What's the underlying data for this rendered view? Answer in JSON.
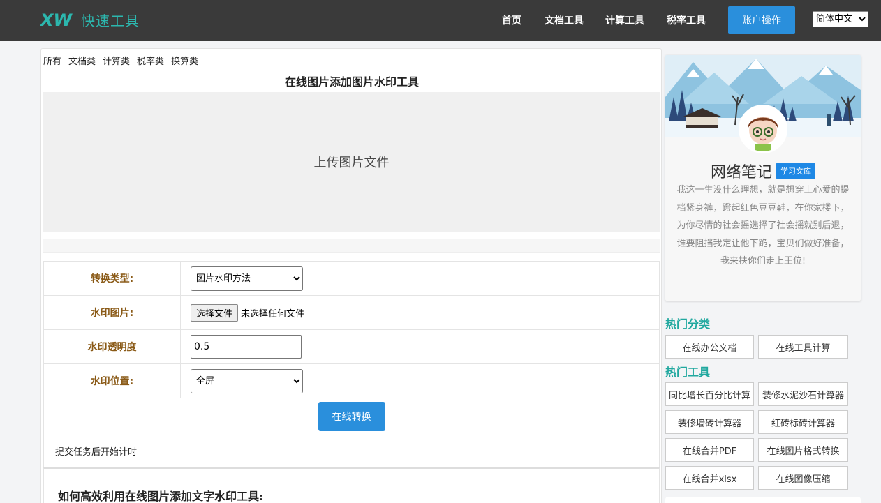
{
  "header": {
    "logo_mark": "XW",
    "logo_text": "快速工具",
    "nav": [
      "首页",
      "文档工具",
      "计算工具",
      "税率工具"
    ],
    "account_label": "账户操作",
    "language": "简体中文",
    "colors": {
      "bar": "#3a3a3a",
      "accent": "#2a8fdc",
      "brand": "#2cb7ae"
    }
  },
  "categories": [
    "所有",
    "文档类",
    "计算类",
    "税率类",
    "换算类"
  ],
  "page_title": "在线图片添加图片水印工具",
  "upload_label": "上传图片文件",
  "form": {
    "type_label": "转换类型:",
    "type_value": "图片水印方法",
    "image_label": "水印图片:",
    "file_button": "选择文件",
    "file_status": "未选择任何文件",
    "opacity_label": "水印透明度",
    "opacity_value": "0.5",
    "position_label": "水印位置:",
    "position_value": "全屏",
    "convert_label": "在线转换"
  },
  "status_text": "提交任务后开始计时",
  "howto_title": "如何高效利用在线图片添加文字水印工具:",
  "profile": {
    "name": "网络笔记",
    "badge": "学习文库",
    "bio": "我这一生没什么理想，就是想穿上心爱的提档紧身裤，蹬起红色豆豆鞋，在你家楼下，为你尽情的社会摇选择了社会摇就别后退，谁要阻挡我定让他下跪，宝贝们做好准备，我来扶你们走上王位!"
  },
  "hot_categories": {
    "title": "热门分类",
    "items": [
      "在线办公文档",
      "在线工具计算"
    ]
  },
  "hot_tools": {
    "title": "热门工具",
    "items": [
      "同比增长百分比计算",
      "装修水泥沙石计算器",
      "装修墙砖计算器",
      "红砖标砖计算器",
      "在线合并PDF",
      "在线图片格式转换",
      "在线合并xlsx",
      "在线图像压缩"
    ]
  }
}
